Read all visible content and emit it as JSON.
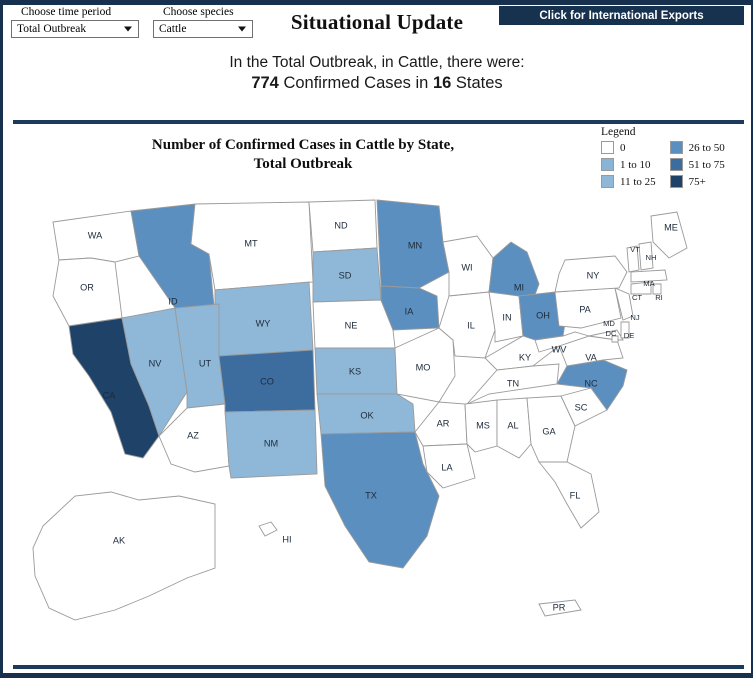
{
  "header": {
    "title": "Situational Update",
    "export_button": "Click for International Exports",
    "time_period": {
      "label": "Choose time period",
      "value": "Total Outbreak"
    },
    "species": {
      "label": "Choose species",
      "value": "Cattle"
    }
  },
  "summary": {
    "line1": "In the Total Outbreak, in Cattle, there were:",
    "cases": "774",
    "cases_text": "Confirmed Cases in",
    "states": "16",
    "states_text": "States"
  },
  "chart_title_line1": "Number of Confirmed Cases in Cattle by State,",
  "chart_title_line2": "Total Outbreak",
  "legend": {
    "title": "Legend",
    "col1": [
      {
        "label": "0",
        "color": "#ffffff"
      },
      {
        "label": "1 to 10",
        "color": "#8ab4d6"
      },
      {
        "label": "11 to 25",
        "color": "#8fb8d8"
      }
    ],
    "col2": [
      {
        "label": "26 to 50",
        "color": "#5b8fbf"
      },
      {
        "label": "51 to 75",
        "color": "#3c6d9e"
      },
      {
        "label": "75+",
        "color": "#1f4269"
      }
    ]
  },
  "colors": {
    "accent": "#16304d",
    "bar": "#1b3a5c",
    "bin0": "#ffffff",
    "bin1": "#9cc0dc",
    "bin2": "#8fb8d8",
    "bin3": "#5b8fbf",
    "bin4": "#3c6d9e",
    "bin5": "#1f4269",
    "stroke": "#9a9a9a"
  },
  "chart_data": {
    "type": "map",
    "title": "Number of Confirmed Cases in Cattle by State, Total Outbreak",
    "legend_position": "top-right",
    "bins": [
      {
        "label": "0",
        "min": 0,
        "max": 0,
        "color": "#ffffff"
      },
      {
        "label": "1 to 10",
        "min": 1,
        "max": 10,
        "color": "#9cc0dc"
      },
      {
        "label": "11 to 25",
        "min": 11,
        "max": 25,
        "color": "#8fb8d8"
      },
      {
        "label": "26 to 50",
        "min": 26,
        "max": 50,
        "color": "#5b8fbf"
      },
      {
        "label": "51 to 75",
        "min": 51,
        "max": 75,
        "color": "#3c6d9e"
      },
      {
        "label": "75+",
        "min": 76,
        "max": null,
        "color": "#1f4269"
      }
    ],
    "total_cases": 774,
    "total_states": 16,
    "states": [
      {
        "code": "WA",
        "bin": "0"
      },
      {
        "code": "OR",
        "bin": "0"
      },
      {
        "code": "ID",
        "bin": "26 to 50"
      },
      {
        "code": "MT",
        "bin": "0"
      },
      {
        "code": "ND",
        "bin": "0"
      },
      {
        "code": "MN",
        "bin": "26 to 50"
      },
      {
        "code": "WI",
        "bin": "0"
      },
      {
        "code": "MI",
        "bin": "26 to 50"
      },
      {
        "code": "SD",
        "bin": "11 to 25"
      },
      {
        "code": "WY",
        "bin": "11 to 25"
      },
      {
        "code": "NV",
        "bin": "11 to 25"
      },
      {
        "code": "UT",
        "bin": "11 to 25"
      },
      {
        "code": "CA",
        "bin": "75+"
      },
      {
        "code": "CO",
        "bin": "51 to 75"
      },
      {
        "code": "NE",
        "bin": "0"
      },
      {
        "code": "IA",
        "bin": "26 to 50"
      },
      {
        "code": "IL",
        "bin": "0"
      },
      {
        "code": "IN",
        "bin": "0"
      },
      {
        "code": "OH",
        "bin": "26 to 50"
      },
      {
        "code": "KS",
        "bin": "11 to 25"
      },
      {
        "code": "MO",
        "bin": "0"
      },
      {
        "code": "KY",
        "bin": "0"
      },
      {
        "code": "AZ",
        "bin": "0"
      },
      {
        "code": "NM",
        "bin": "11 to 25"
      },
      {
        "code": "OK",
        "bin": "11 to 25"
      },
      {
        "code": "AR",
        "bin": "0"
      },
      {
        "code": "TN",
        "bin": "0"
      },
      {
        "code": "NC",
        "bin": "26 to 50"
      },
      {
        "code": "SC",
        "bin": "0"
      },
      {
        "code": "MS",
        "bin": "0"
      },
      {
        "code": "AL",
        "bin": "0"
      },
      {
        "code": "GA",
        "bin": "0"
      },
      {
        "code": "TX",
        "bin": "26 to 50"
      },
      {
        "code": "LA",
        "bin": "0"
      },
      {
        "code": "FL",
        "bin": "0"
      },
      {
        "code": "PA",
        "bin": "0"
      },
      {
        "code": "NY",
        "bin": "0"
      },
      {
        "code": "VT",
        "bin": "0"
      },
      {
        "code": "NH",
        "bin": "0"
      },
      {
        "code": "ME",
        "bin": "0"
      },
      {
        "code": "MA",
        "bin": "0"
      },
      {
        "code": "CT",
        "bin": "0"
      },
      {
        "code": "RI",
        "bin": "0"
      },
      {
        "code": "NJ",
        "bin": "0"
      },
      {
        "code": "DE",
        "bin": "0"
      },
      {
        "code": "MD",
        "bin": "0"
      },
      {
        "code": "DC",
        "bin": "0"
      },
      {
        "code": "WV",
        "bin": "0"
      },
      {
        "code": "VA",
        "bin": "0"
      },
      {
        "code": "AK",
        "bin": "0"
      },
      {
        "code": "HI",
        "bin": "0"
      },
      {
        "code": "PR",
        "bin": "0"
      }
    ]
  },
  "state_labels": {
    "WA": "WA",
    "OR": "OR",
    "ID": "ID",
    "MT": "MT",
    "ND": "ND",
    "MN": "MN",
    "WI": "WI",
    "MI": "MI",
    "SD": "SD",
    "WY": "WY",
    "NV": "NV",
    "UT": "UT",
    "CA": "CA",
    "CO": "CO",
    "NE": "NE",
    "IA": "IA",
    "IL": "IL",
    "IN": "IN",
    "OH": "OH",
    "KS": "KS",
    "MO": "MO",
    "KY": "KY",
    "AZ": "AZ",
    "NM": "NM",
    "OK": "OK",
    "AR": "AR",
    "TN": "TN",
    "NC": "NC",
    "SC": "SC",
    "MS": "MS",
    "AL": "AL",
    "GA": "GA",
    "TX": "TX",
    "LA": "LA",
    "FL": "FL",
    "PA": "PA",
    "NY": "NY",
    "VT": "VT",
    "NH": "NH",
    "ME": "ME",
    "MA": "MA",
    "CT": "CT",
    "RI": "RI",
    "NJ": "NJ",
    "DE": "DE",
    "MD": "MD",
    "DC": "DC",
    "WV": "WV",
    "VA": "VA",
    "AK": "AK",
    "HI": "HI",
    "PR": "PR"
  }
}
